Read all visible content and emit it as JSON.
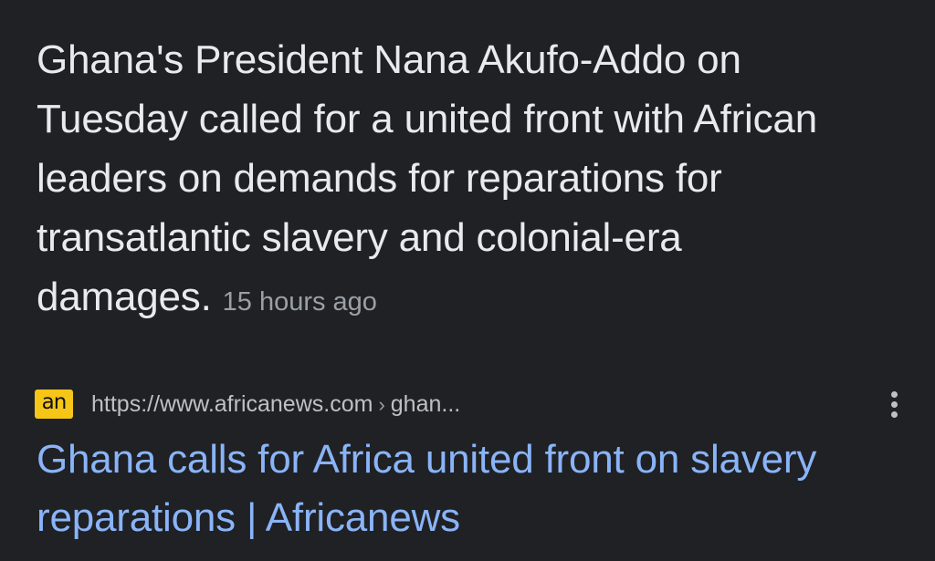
{
  "snippet": {
    "text": "Ghana's President Nana Akufo-Addo on Tuesday called for a united front with African leaders on demands for reparations for transatlantic slavery and colonial-era damages.",
    "time": "15 hours ago"
  },
  "result": {
    "favicon_text": "an",
    "favicon_color": "#f5c518",
    "url": "https://www.africanews.com",
    "separator": "›",
    "path": "ghan...",
    "title": "Ghana calls for Africa united front on slavery reparations | Africanews",
    "title_color": "#8ab4f8",
    "more_icon": "more-vert-icon"
  }
}
